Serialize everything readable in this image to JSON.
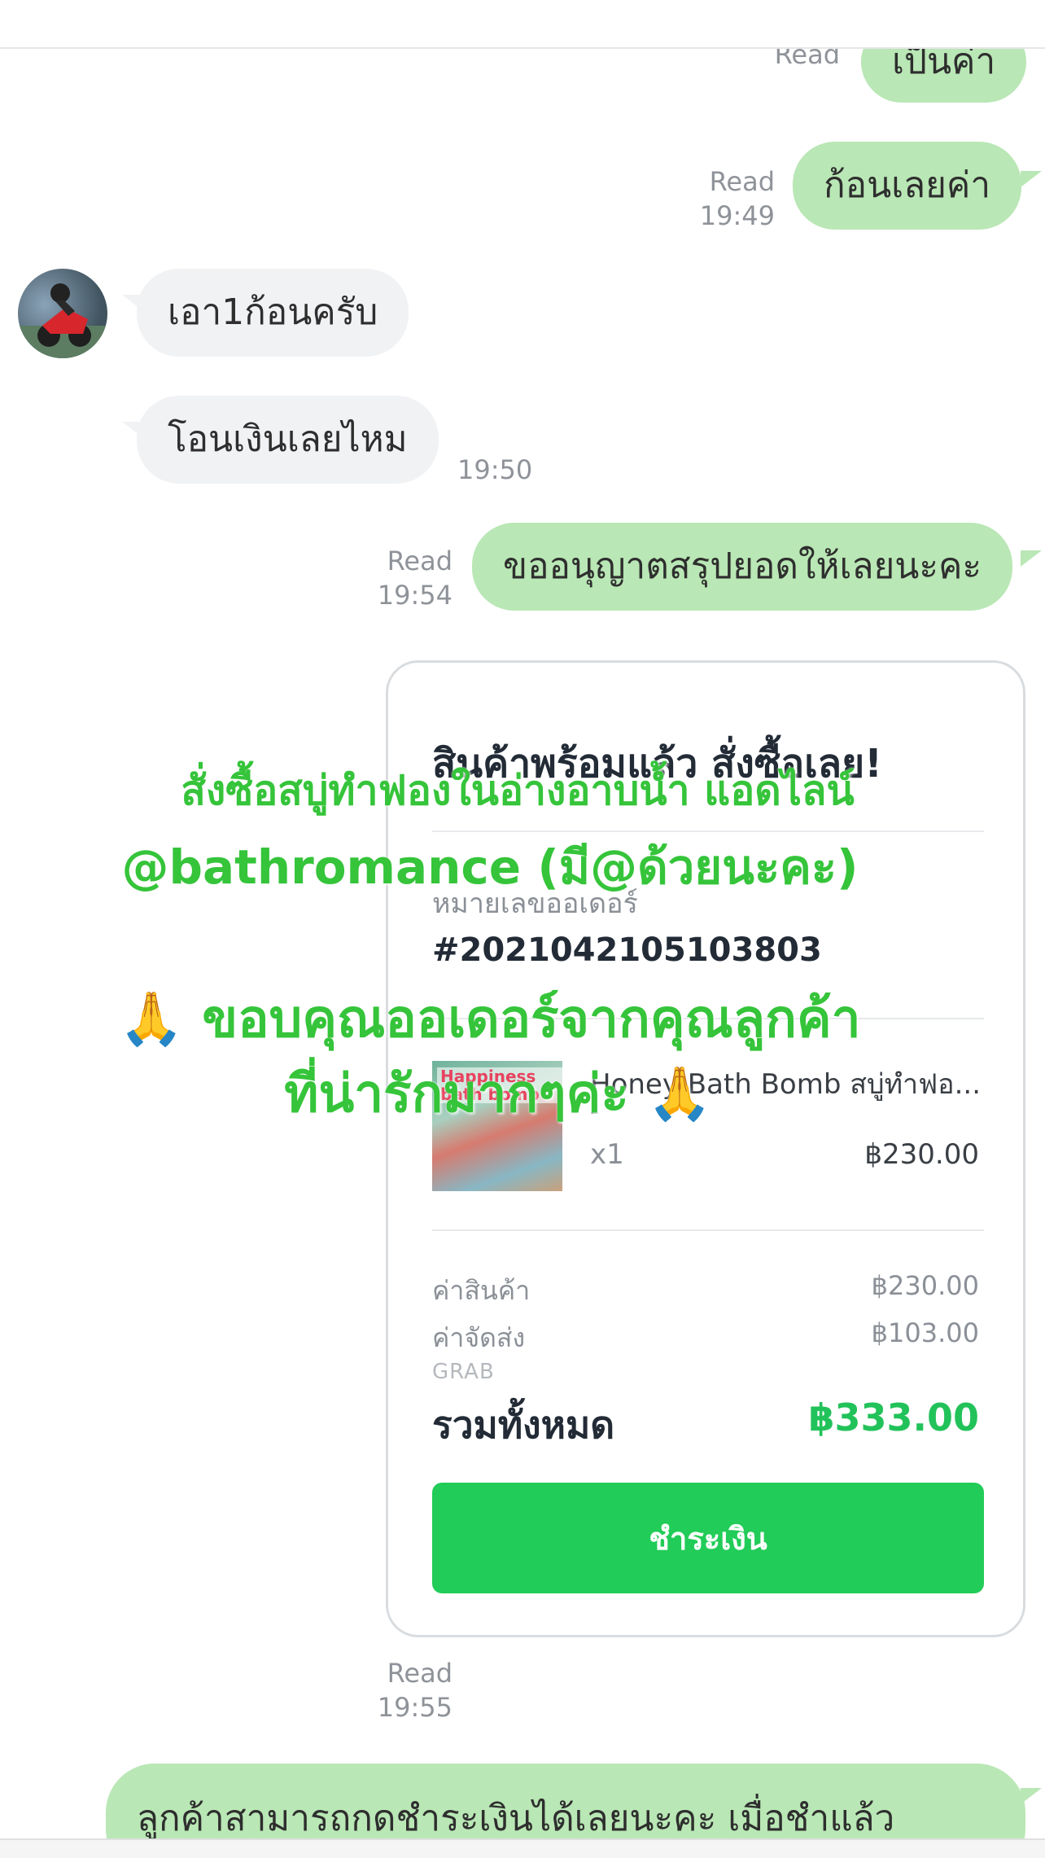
{
  "messages": {
    "m0": {
      "text": "เป็นค่า",
      "status": "Read"
    },
    "m1": {
      "text": "ก้อนเลยค่า",
      "status": "Read",
      "time": "19:49"
    },
    "m2": {
      "text": "เอา1ก้อนครับ"
    },
    "m3": {
      "text": "โอนเงินเลยไหม",
      "time": "19:50"
    },
    "m4": {
      "text": "ขออนุญาตสรุปยอดให้เลยนะคะ",
      "status": "Read",
      "time": "19:54"
    },
    "m6": {
      "text": "ลูกค้าสามารถกดชำระเงินได้เลยนะคะ เมื่อชำแล้ว"
    }
  },
  "order_card": {
    "title": "สินค้าพร้อมแล้ว สั่งซื้อเลย!",
    "order_label": "หมายเลขออเดอร์",
    "order_number": "#2021042105103803",
    "product": {
      "thumb_text": "Happiness bath bomb",
      "name": "Honey Bath Bomb สบู่ทำฟอ...",
      "variant": "-",
      "quantity": "x1",
      "price": "฿230.00"
    },
    "subtotal_label": "ค่าสินค้า",
    "subtotal_value": "฿230.00",
    "shipping_label": "ค่าจัดส่ง",
    "shipping_value": "฿103.00",
    "shipping_method": "GRAB",
    "total_label": "รวมทั้งหมด",
    "total_value": "฿333.00",
    "pay_button": "ชำระเงิน",
    "status": "Read",
    "time": "19:55"
  },
  "overlay": {
    "line1": "สั่งซื้อสบู่ทำฟองในอ่างอาบน้ำ แอดไลน์",
    "line2": "@bathromance (มี@ด้วยนะคะ)",
    "line3": "ขอบคุณออเดอร์จากคุณลูกค้า",
    "line4": "ที่น่ารักมากๆค่ะ",
    "emoji": "🙏"
  },
  "colors": {
    "my_bubble": "#b9e7b5",
    "their_bubble": "#f1f2f4",
    "accent_green": "#21cc58",
    "overlay_green": "#35c43a"
  },
  "icons": {
    "avatar": "motorbike-rider-avatar",
    "emoji": "folded-hands-emoji"
  }
}
